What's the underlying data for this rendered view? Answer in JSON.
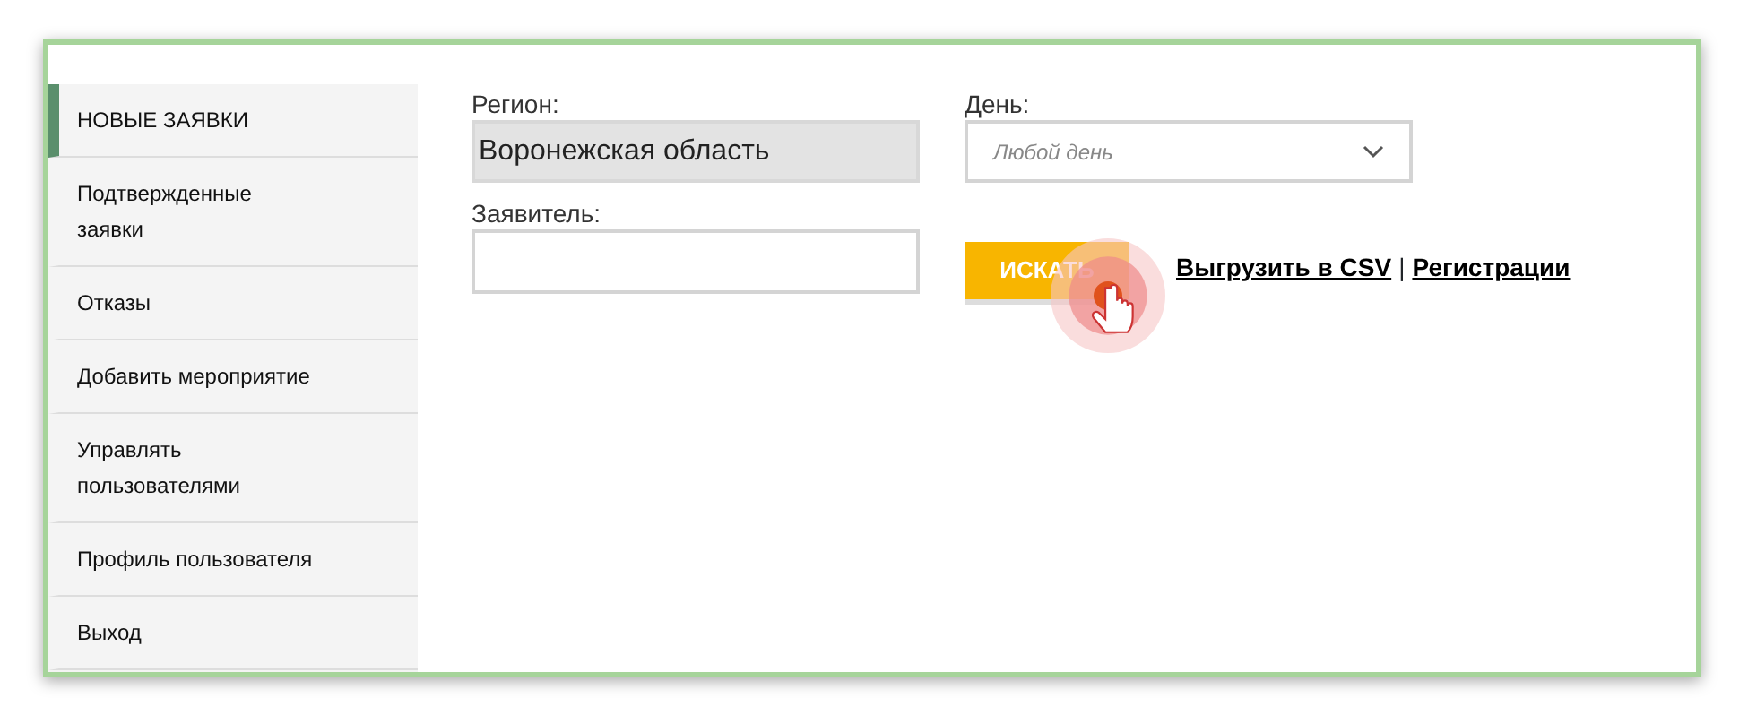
{
  "sidebar": {
    "items": [
      {
        "label": "НОВЫЕ ЗАЯВКИ",
        "selected": true
      },
      {
        "label": "Подтвержденные заявки",
        "selected": false
      },
      {
        "label": "Отказы",
        "selected": false
      },
      {
        "label": "Добавить мероприятие",
        "selected": false
      },
      {
        "label": "Управлять пользователями",
        "selected": false
      },
      {
        "label": "Профиль пользователя",
        "selected": false
      },
      {
        "label": "Выход",
        "selected": false
      }
    ]
  },
  "filters": {
    "region": {
      "label": "Регион:",
      "value": "Воронежская область"
    },
    "day": {
      "label": "День:",
      "placeholder": "Любой день"
    },
    "applicant": {
      "label": "Заявитель:"
    }
  },
  "search_button": "ИСКАТЬ",
  "links": [
    {
      "label": "Выгрузить в CSV"
    },
    {
      "label": "Регистрации"
    }
  ],
  "link_separator": "|"
}
